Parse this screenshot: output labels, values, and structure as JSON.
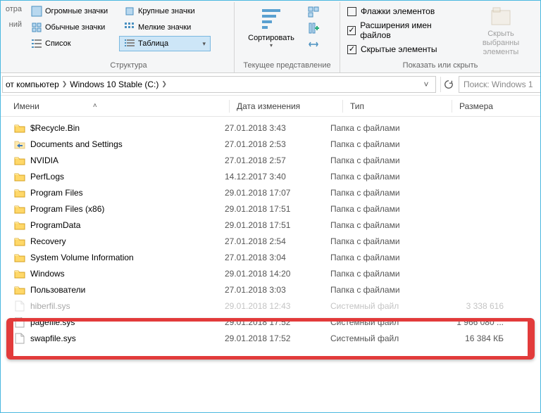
{
  "ribbon": {
    "left": {
      "line1": "отра",
      "line2": "ний"
    },
    "layout": {
      "huge": "Огромные значки",
      "large": "Крупные значки",
      "normal": "Обычные значки",
      "small": "Мелкие значки",
      "list": "Список",
      "table": "Таблица",
      "group_label": "Структура"
    },
    "sort": {
      "label": "Сортировать",
      "group_label": "Текущее представление"
    },
    "checks": {
      "flags": "Флажки элементов",
      "ext": "Расширения имен файлов",
      "hidden": "Скрытые элементы",
      "group_label": "Показать или скрыть"
    },
    "hide": {
      "line1": "Скрыть выбранны",
      "line2": "элементы"
    }
  },
  "address": {
    "crumb1": "от компьютер",
    "crumb2": "Windows 10 Stable (C:)",
    "search_placeholder": "Поиск: Windows 1"
  },
  "columns": {
    "name": "Имени",
    "date": "Дата изменения",
    "type": "Тип",
    "size": "Размера"
  },
  "files": [
    {
      "icon": "folder",
      "name": "$Recycle.Bin",
      "date": "27.01.2018 3:43",
      "type": "Папка с файлами",
      "size": ""
    },
    {
      "icon": "junction",
      "name": "Documents and Settings",
      "date": "27.01.2018 2:53",
      "type": "Папка с файлами",
      "size": ""
    },
    {
      "icon": "folder",
      "name": "NVIDIA",
      "date": "27.01.2018 2:57",
      "type": "Папка с файлами",
      "size": ""
    },
    {
      "icon": "folder",
      "name": "PerfLogs",
      "date": "14.12.2017 3:40",
      "type": "Папка с файлами",
      "size": ""
    },
    {
      "icon": "folder",
      "name": "Program Files",
      "date": "29.01.2018 17:07",
      "type": "Папка с файлами",
      "size": ""
    },
    {
      "icon": "folder",
      "name": "Program Files (x86)",
      "date": "29.01.2018 17:51",
      "type": "Папка с файлами",
      "size": ""
    },
    {
      "icon": "folder",
      "name": "ProgramData",
      "date": "29.01.2018 17:51",
      "type": "Папка с файлами",
      "size": ""
    },
    {
      "icon": "folder",
      "name": "Recovery",
      "date": "27.01.2018 2:54",
      "type": "Папка с файлами",
      "size": ""
    },
    {
      "icon": "folder",
      "name": "System Volume Information",
      "date": "27.01.2018 3:04",
      "type": "Папка с файлами",
      "size": ""
    },
    {
      "icon": "folder",
      "name": "Windows",
      "date": "29.01.2018 14:20",
      "type": "Папка с файлами",
      "size": ""
    },
    {
      "icon": "folder",
      "name": "Пользователи",
      "date": "27.01.2018 3:03",
      "type": "Папка с файлами",
      "size": ""
    },
    {
      "icon": "file",
      "name": "hiberfil.sys",
      "date": "29.01.2018 12:43",
      "type": "Системный файл",
      "size": "3 338 616"
    },
    {
      "icon": "file",
      "name": "pagefile.sys",
      "date": "29.01.2018 17:52",
      "type": "Системный файл",
      "size": "1 966 080 ..."
    },
    {
      "icon": "file",
      "name": "swapfile.sys",
      "date": "29.01.2018 17:52",
      "type": "Системный файл",
      "size": "16 384 КБ"
    }
  ]
}
